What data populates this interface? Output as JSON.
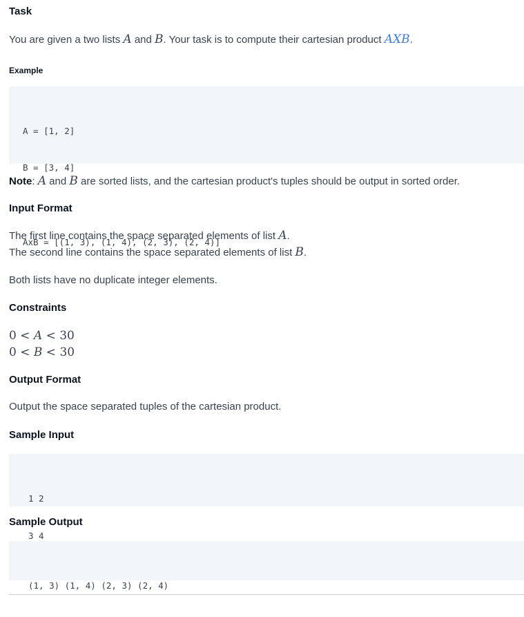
{
  "task": {
    "heading": "Task",
    "intro_pre": "You are given a two lists ",
    "var_a": "A",
    "and": " and ",
    "var_b": "B",
    "intro_mid": ". Your task is to compute their cartesian product ",
    "axb": "AXB",
    "period": "."
  },
  "example": {
    "heading": "Example",
    "code_lines": [
      "A = [1, 2]",
      "B = [3, 4]",
      "",
      "AxB = [(1, 3), (1, 4), (2, 3), (2, 4)]"
    ]
  },
  "note": {
    "label": "Note",
    "colon": ": ",
    "var_a": "A",
    "and": " and ",
    "var_b": "B",
    "text": " are sorted lists, and the cartesian product's tuples should be output in sorted order."
  },
  "input_format": {
    "heading": "Input Format",
    "line1": "The first line contains the space separated elements of list ",
    "line1_var": "A",
    "line2": "The second line contains the space separated elements of list ",
    "line2_var": "B",
    "period": ".",
    "extra": "Both lists have no duplicate integer elements."
  },
  "constraints": {
    "heading": "Constraints",
    "c1_lo": "0",
    "c1_op1": " < ",
    "c1_var": "A",
    "c1_op2": " < ",
    "c1_hi": "30",
    "c2_lo": "0",
    "c2_op1": " < ",
    "c2_var": "B",
    "c2_op2": " < ",
    "c2_hi": "30"
  },
  "output_format": {
    "heading": "Output Format",
    "text": "Output the space separated tuples of the cartesian product."
  },
  "sample_input": {
    "heading": "Sample Input",
    "code_lines": [
      "1 2",
      "3 4"
    ]
  },
  "sample_output": {
    "heading": "Sample Output",
    "code_lines": [
      "(1, 3) (1, 4) (2, 3) (2, 4)"
    ]
  }
}
